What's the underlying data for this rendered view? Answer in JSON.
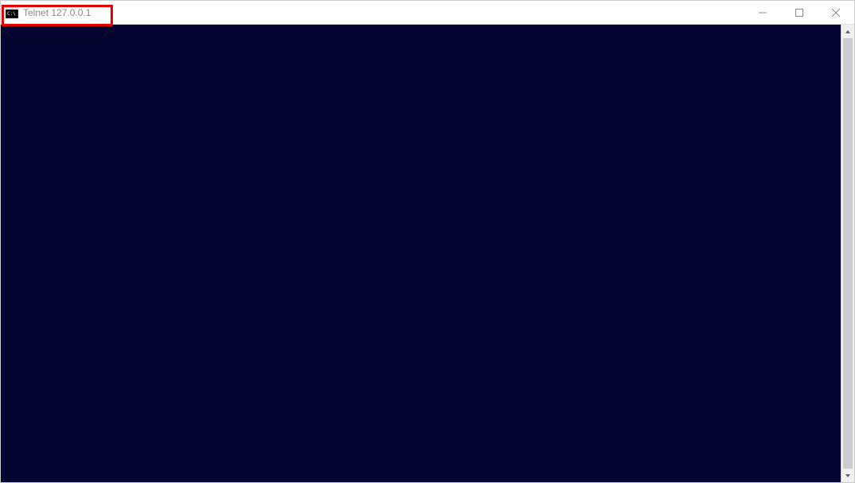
{
  "window": {
    "title": "Telnet 127.0.0.1"
  },
  "terminal": {
    "background_color": "#050531"
  },
  "highlight": {
    "color": "#e60000"
  }
}
